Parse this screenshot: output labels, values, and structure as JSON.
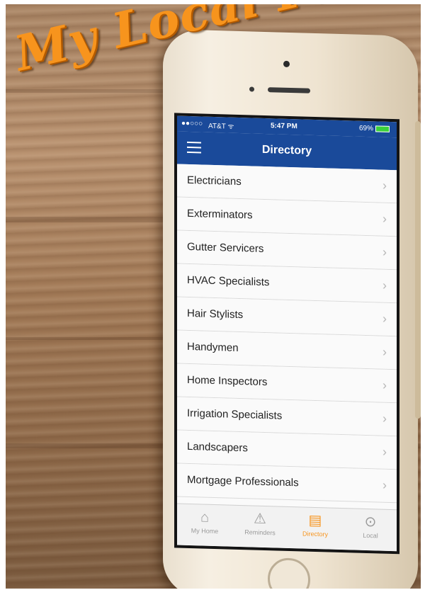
{
  "brand": {
    "title": "My Local Pros"
  },
  "status_bar": {
    "signal": "●●○○○",
    "carrier": "AT&T ᯤ",
    "time": "5:47 PM",
    "battery": "69%"
  },
  "nav": {
    "title": "Directory"
  },
  "directory": {
    "items": [
      {
        "label": "Electricians"
      },
      {
        "label": "Exterminators"
      },
      {
        "label": "Gutter Servicers"
      },
      {
        "label": "HVAC Specialists"
      },
      {
        "label": "Hair Stylists"
      },
      {
        "label": "Handymen"
      },
      {
        "label": "Home Inspectors"
      },
      {
        "label": "Irrigation Specialists"
      },
      {
        "label": "Landscapers"
      },
      {
        "label": "Mortgage Professionals"
      }
    ],
    "chevron": "›"
  },
  "tabs": [
    {
      "label": "My Home",
      "icon": "house-icon",
      "glyph": "⌂",
      "active": false
    },
    {
      "label": "Reminders",
      "icon": "warning-icon",
      "glyph": "⚠",
      "active": false
    },
    {
      "label": "Directory",
      "icon": "directory-icon",
      "glyph": "▤",
      "active": true
    },
    {
      "label": "Local",
      "icon": "location-pin-icon",
      "glyph": "⊙",
      "active": false
    }
  ],
  "colors": {
    "accent": "#f7941d",
    "navbar": "#1a4a9a"
  }
}
